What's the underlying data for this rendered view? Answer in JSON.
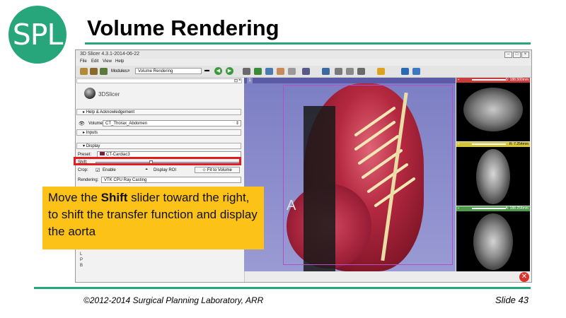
{
  "slide": {
    "logo_text": "SPL",
    "title": "Volume Rendering",
    "footer_left": "©2012-2014 Surgical Planning Laboratory, ARR",
    "footer_right": "Slide 43",
    "callout": {
      "pre": "Move the ",
      "bold": "Shift",
      "post": " slider toward the right, to shift the transfer function and display the aorta"
    },
    "accent_color": "#27a57b",
    "callout_color": "#fcc218",
    "highlight_color": "#e11d1d"
  },
  "app": {
    "window_title": "3D Slicer 4.3.1-2014-06-22",
    "menu": [
      "File",
      "Edit",
      "View",
      "Help"
    ],
    "toolbar": {
      "modules_label": "Modules:",
      "module_value": "Volume Rendering"
    },
    "panel": {
      "logo_text": "3DSlicer",
      "help_section": "Help & Acknowledgement",
      "volume_label": "Volume:",
      "volume_value": "CT_Thorax_Abdomen",
      "inputs_section": "Inputs",
      "display_section": "Display",
      "preset_label": "Preset:",
      "preset_value": "CT-Cardiac3",
      "shift_label": "Shift:",
      "shift_value_fraction": 0.38,
      "crop_label": "Crop:",
      "enable_label": "Enable",
      "display_roi_label": "Display ROI",
      "fit_button": "Fit to Volume",
      "rendering_label": "Rendering:",
      "rendering_value": "VTK CPU Ray Casting",
      "orient_letters": [
        "L",
        "P",
        "B"
      ]
    },
    "view3d": {
      "orientation_label": "A"
    },
    "slices": [
      {
        "name": "red",
        "color": "#c83c3c",
        "label": "S: 188.500mm"
      },
      {
        "name": "yellow",
        "color": "#d4c43a",
        "label": "R: 7.254mm"
      },
      {
        "name": "green",
        "color": "#4a9a4a",
        "label": "A: 188.254mm"
      }
    ]
  }
}
